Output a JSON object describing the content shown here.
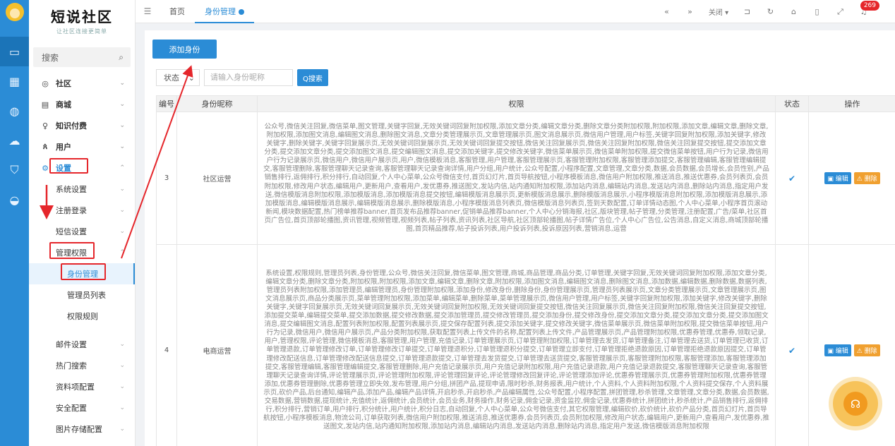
{
  "logo": {
    "title": "短说社区",
    "subtitle": "让社区连接更简单"
  },
  "sidebar": {
    "search_placeholder": "搜索",
    "items": [
      {
        "label": "社区",
        "icon": "chat-icon"
      },
      {
        "label": "商城",
        "icon": "shop-icon"
      },
      {
        "label": "知识付费",
        "icon": "bulb-icon"
      },
      {
        "label": "用户",
        "icon": "users-icon"
      },
      {
        "label": "设置",
        "icon": "gear-icon"
      }
    ],
    "settings": {
      "system": "系统设置",
      "register": "注册登录",
      "sms": "短信设置",
      "admin_perm": "管理权限",
      "admin_sub": [
        "身份管理",
        "管理员列表",
        "权限规则"
      ],
      "rest": [
        "邮件设置",
        "热门搜索",
        "资料项配置",
        "安全配置",
        "图片存储配置"
      ]
    }
  },
  "topbar": {
    "tabs": [
      "首页",
      "身份管理"
    ],
    "close_label": "关闭",
    "badge": "269"
  },
  "toolbar": {
    "add_label": "添加身份"
  },
  "filter": {
    "status_label": "状态",
    "nickname_placeholder": "请输入身份昵称",
    "search_label": "Q搜索"
  },
  "table": {
    "headers": [
      "编号",
      "身份昵称",
      "权限",
      "状态",
      "操作"
    ],
    "edit_label": "编辑",
    "delete_label": "删除",
    "rows": [
      {
        "id": "3",
        "name": "社区运营",
        "perm": "公众号,微信关注回复,微信菜单,图文管理,关键字回复,无效关键词回复附加权限,添加文章分类,编辑文章分类,删除文章分类附加权限,附加权限,添加文章,编辑文章,删除文章,附加权限,添加图文消息,编辑图文消息,删除图文消息,文章分类管理展示页,文章管理展示页,图文消息展示页,微信用户管理,用户标签,关键字回复附加权限,添加关键字,修改关键字,删除关键字,关键字回复展示页,无效关键词回复展示页,无效关键词回复提交按钮,微信关注回复展示页,微信关注回复附加权限,微信关注回复提交按钮,提交添加文章分类,提交添加文章分类,提交添加图文消息,提交编辑图文消息,提交添加关键字,提交修改关键字,微信菜单展示页,微信菜单附加权限,提交微信菜单按钮,用户行为记录,微信用户行为记录展示页,微信用户,微信用户展示页,用户,微信模板消息,客服管理,用户管理,客服管理展示页,客服管理附加权限,客服管理添加提交,客服管理编辑,客服管理编辑提交,客服管理删除,客服管理聊天记录查询,客服管理聊天记录查询详情,用户分组,用户统计,公众号配置,小程序配置,文章管理,文章分类,数据,会员数据,会员增长,会员性别,产品销售排行,返佣排行,积分排行,自动回复,个人中心菜单,公众号微信支付,首页幻灯片,首页导航按钮,小程序模板消息,微信用户附加权限,推送消息,推送优惠券,会员列表页,会员附加权限,修改用户状态,编辑用户,更新用户,查看用户,发优惠券,推送图文,发站内信,站内通知附加权限,添加站内消息,编辑站内消息,发送站内消息,删除站内消息,指定用户发送,微信模版消息附加权限,添加模版消息,添加模版消息提交按钮,编辑模版消息展示页,更新模版消息展示,删除模版消息展示,小程序模版消息附加权限,添加模版消息展示,添加模版消息,编辑模版消息展示,编辑模版消息展示,删除模版消息,小程序模版消息列表页,微信模版消息列表页,签到天数配置,订单详情动态图,个人中心菜单,小程序首页滚动新闻,模块数据配置,热门榜单推荐banner,首页发布品推荐banner,促销单品推荐banner,个人中心分销海报,社区,版块管理,帖子管理,分类管理,注册配置,广告/菜单,社区首页广告位,首页顶部轮播图,资讯管理,视频管理,视频列表,帖子列表,资讯列表,社区导航,社区顶部轮播图,帖子详情广告位,个人中心广告位,公告消息,自定义消息,商城顶部轮播图,首页精品推荐,帖子投诉列表,用户投诉列表,投诉原因列表,营销消息,运营"
      },
      {
        "id": "4",
        "name": "电商运营",
        "perm": "系统设置,权限规则,管理员列表,身份管理,公众号,微信关注回复,微信菜单,图文管理,商城,商品管理,商品分类,订单管理,关键字回复,无效关键词回复附加权限,添加文章分类,编辑文章分类,删除文章分类,附加权限,附加权限,添加文章,编辑文章,删除文章,附加权限,添加图文消息,编辑图文消息,删除图文消息,添加数据,编辑数据,删除数据,数据列表,管理员列表附加权限,添加管理员,编辑管理员,身份管理附加权限,添加身份,修改身份,删除身份,身份管理展示页,管理员列表展示页,文章分类管理展示页,文章管理展示页,图文消息展示页,商品分类展示页,菜单管理附加权限,添加菜单,编辑菜单,删除菜单,菜单管理展示页,微信用户管理,用户标签,关键字回复附加权限,添加关键字,修改关键字,删除关键字,关键字回复展示页,无效关键词回复展示页,无效关键词回复附加权限,无效关键词回复提交按钮,微信关注回复展示页,微信关注回复附加权限,微信关注回复提交按钮,添加提交菜单,编辑提交菜单,提交添加数据,提交修改数据,提交添加管理员,提交修改管理员,提交添加身份,提交修改身份,提交添加文章分类,提交添加文章分类,提交添加图文消息,提交编辑图文消息,配置列表附加权限,配置列表展示页,提交保存配置列表,提交添加关键字,提交修改关键字,微信菜单展示页,微信菜单附加权限,提交微信菜单按钮,用户行为记录,微信用户,微信用户展示页,产品分类附加权限,获取配置列表上传文件的名称,配置列表上传文件,产品管理展示页,产品管理附加权限,优惠券管理,优惠券,领取记录,用户,管理权限,评论管理,微信模板消息,客服管理,用户管理,充值记录,订单管理展示页,订单管理附加权限,订单管理去发货,订单管理备注,订单管理去送货,订单管理已收货,订单管理退款,订单管理修改订单,订单管理修改订单提交,订单管理退积分,订单管理退积分提交,订单管理立即支付,订单管理拒绝退款原因,订单管理拒绝退款原因提交,订单管理修改配送信息,订单管理修改配送信息提交,订单管理退款提交,订单管理去发货提交,订单管理去送货提交,客服管理展示页,客服管理附加权限,客服管理添加,客服管理添加提交,客服管理编辑,客服管理编辑提交,客服管理删除,用户充值记录展示页,用户充值记录附加权限,用户充值记录退款,用户充值记录退款提交,客服管理聊天记录查询,客服管理聊天记录查询详情,评论管理展示页,评论管理附加权限,评论管理回复评论,评论管理修改回复评论,评论管理添加评论,优惠券管理展示页,优惠券管理附加权限,优惠券管理添加,优惠券管理删除,优惠券管理立即失效,发布管理,用户分组,拼团产品,提现申请,限时秒杀,财务报表,用户统计,个人资料,个人资料附加权限,个人资料提交保存,个人资料展示页,砍价产品,后台通知,编辑产品,添加产品,编辑产品详情,开启秒杀,开启秒杀,产品编辑属性,公众号配置,小程序配置,拼团管理,秒杀管理,文章管理,文章分类,数据,会员数据,交易数据,营销数据,提现统计,充值统计,返佣统计,会员统计,会员业务,财务操作,财务记录,佣金记录,资金监控,佣金记录,优惠券统计,拼团统计,秒杀统计,产品销售排行,返佣排行,积分排行,营销订单,用户排行,积分统计,用户统计,积分日志,自动回复,个人中心菜单,公众号微信支付,其它权限管理,编辑砍价,砍价统计,砍价产品分类,首页幻灯片,首页导航按钮,小程序模板消息,物流公司,订单获取列表,微信用户附加权限,推送消息,推送优惠券,会员列表页,会员附加权限,修改用户状态,编辑用户,更新用户,查看用户,发优惠券,推送图文,发站内信,站内通知附加权限,添加站内消息,编辑站内消息,发送站内消息,删除站内消息,指定用户发送,微信模版消息附加权限"
      }
    ]
  },
  "colors": {
    "accent": "#2b8cd6",
    "annotation": "#e5262b",
    "warning": "#f0a030"
  }
}
